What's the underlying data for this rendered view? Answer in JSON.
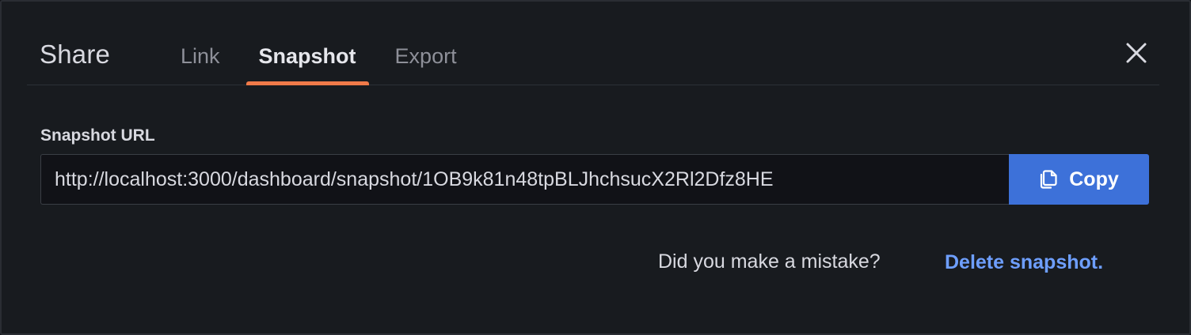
{
  "modal": {
    "title": "Share",
    "tabs": [
      {
        "label": "Link",
        "active": false
      },
      {
        "label": "Snapshot",
        "active": true
      },
      {
        "label": "Export",
        "active": false
      }
    ],
    "close_icon": "close-icon"
  },
  "snapshot": {
    "url_label": "Snapshot URL",
    "url_value": "http://localhost:3000/dashboard/snapshot/1OB9k81n48tpBLJhchsucX2Rl2Dfz8HE",
    "copy_label": "Copy",
    "copy_icon": "copy-icon",
    "mistake_text": "Did you make a mistake?",
    "delete_link": "Delete snapshot."
  },
  "colors": {
    "background": "#181b1f",
    "accent_tab": "#f07a49",
    "primary_button": "#3d71d9",
    "link": "#6e9fff"
  }
}
